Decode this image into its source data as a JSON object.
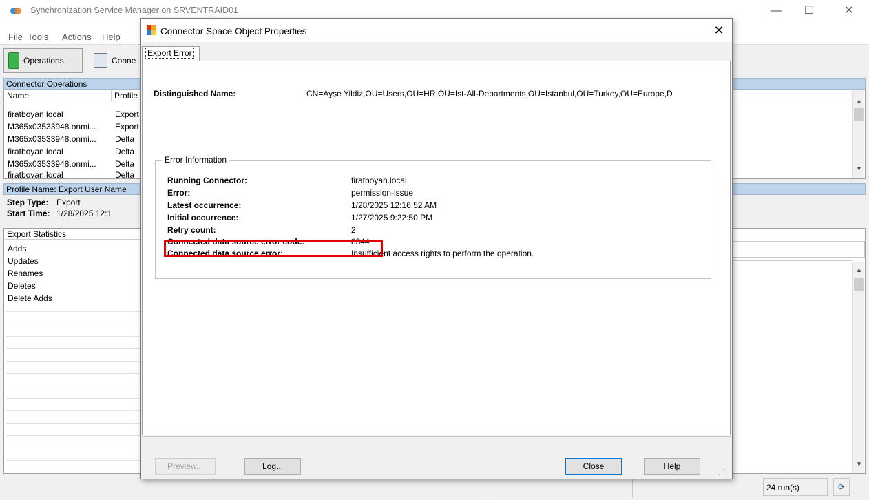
{
  "main": {
    "title": "Synchronization Service Manager on SRVENTRAID01",
    "menu": [
      "File",
      "Tools",
      "Actions",
      "Help"
    ],
    "toolbar": {
      "operations": "Operations",
      "connectors": "Conne"
    },
    "connector_operations": {
      "header": "Connector Operations",
      "columns": [
        "Name",
        "Profile"
      ],
      "rows": [
        {
          "name": "firatboyan.local",
          "profile": "Export"
        },
        {
          "name": "M365x03533948.onmi...",
          "profile": "Export"
        },
        {
          "name": "M365x03533948.onmi...",
          "profile": "Delta"
        },
        {
          "name": "firatboyan.local",
          "profile": "Delta"
        },
        {
          "name": "M365x03533948.onmi...",
          "profile": "Delta"
        },
        {
          "name": "firatboyan.local",
          "profile": "Delta"
        }
      ]
    },
    "profile_bar": "Profile Name: Export  User Name",
    "step_type_label": "Step Type:",
    "step_type_value": "Export",
    "start_time_label": "Start Time:",
    "start_time_value": "1/28/2025 12:1",
    "export_stats": {
      "header": "Export Statistics",
      "items": [
        "Adds",
        "Updates",
        "Renames",
        "Deletes",
        "Delete Adds"
      ]
    },
    "status_runs": "24 run(s)"
  },
  "dialog": {
    "title": "Connector Space Object Properties",
    "tab": "Export Error",
    "dn_label": "Distinguished Name:",
    "dn_value": "CN=Ayşe Yildiz,OU=Users,OU=HR,OU=Ist-All-Departments,OU=Istanbul,OU=Turkey,OU=Europe,D",
    "group_title": "Error Information",
    "fields": [
      {
        "label": "Running Connector:",
        "value": "firatboyan.local"
      },
      {
        "label": "Error:",
        "value": "permission-issue"
      },
      {
        "label": "Latest occurrence:",
        "value": "1/28/2025 12:16:52 AM"
      },
      {
        "label": "Initial occurrence:",
        "value": "1/27/2025 9:22:50 PM"
      },
      {
        "label": "Retry count:",
        "value": "2"
      },
      {
        "label": "Connected data source error code:",
        "value": "8344"
      },
      {
        "label": "Connected data source error:",
        "value": "Insufficient access rights to perform the operation."
      }
    ],
    "buttons": {
      "preview": "Preview...",
      "log": "Log...",
      "close": "Close",
      "help": "Help"
    },
    "close_glyph": "✕"
  }
}
